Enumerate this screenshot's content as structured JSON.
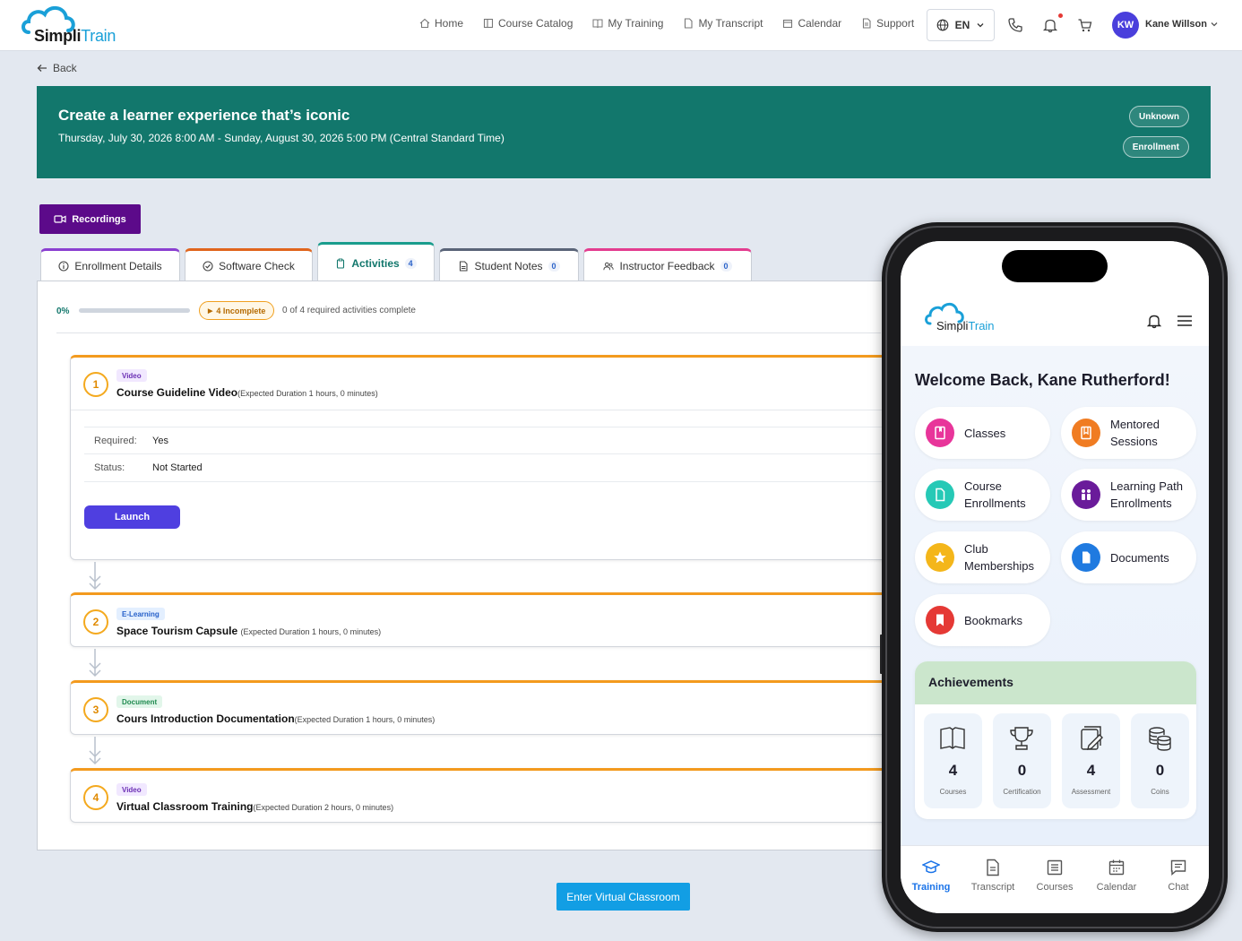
{
  "brand": {
    "name_a": "Simpli",
    "name_b": "Train"
  },
  "nav": {
    "items": [
      {
        "label": "Home",
        "icon": "home-icon"
      },
      {
        "label": "Course Catalog",
        "icon": "catalog-icon"
      },
      {
        "label": "My Training",
        "icon": "book-icon"
      },
      {
        "label": "My Transcript",
        "icon": "file-icon"
      },
      {
        "label": "Calendar",
        "icon": "calendar-icon"
      },
      {
        "label": "Support",
        "icon": "support-icon"
      }
    ],
    "language": "EN",
    "user_initials": "KW",
    "user_name": "Kane Willson"
  },
  "back_label": "Back",
  "banner": {
    "title": "Create a learner experience that’s iconic",
    "date": "Thursday, July 30, 2026 8:00 AM - Sunday, August 30, 2026 5:00 PM (Central Standard Time)",
    "pill_status": "Unknown",
    "pill_type": "Enrollment"
  },
  "recordings_label": "Recordings",
  "tabs": [
    {
      "label": "Enrollment Details",
      "count": ""
    },
    {
      "label": "Software Check",
      "count": ""
    },
    {
      "label": "Activities",
      "count": "4"
    },
    {
      "label": "Student Notes",
      "count": "0"
    },
    {
      "label": "Instructor Feedback",
      "count": "0"
    }
  ],
  "progress": {
    "percent_label": "0%",
    "fraction": 0,
    "incomplete_label": "4 Incomplete",
    "summary": "0 of 4 required activities complete"
  },
  "activities": [
    {
      "number": "1",
      "type": "Video",
      "title": "Course Guideline Video",
      "duration": "(Expected Duration 1 hours, 0 minutes)"
    },
    {
      "number": "2",
      "type": "E-Learning",
      "title": "Space Tourism Capsule ",
      "duration": "(Expected Duration 1 hours, 0 minutes)"
    },
    {
      "number": "3",
      "type": "Document",
      "title": "Cours Introduction Documentation",
      "duration": "(Expected Duration 1 hours, 0 minutes)"
    },
    {
      "number": "4",
      "type": "Video",
      "title": "Virtual Classroom Training",
      "duration": "(Expected Duration 2 hours, 0 minutes)"
    }
  ],
  "activity_details": {
    "required_key": "Required:",
    "required_value": "Yes",
    "status_key": "Status:",
    "status_value": "Not Started",
    "launch_label": "Launch"
  },
  "enter_classroom_label": "Enter Virtual Classroom",
  "mobile": {
    "brand_a": "Simpli",
    "brand_b": "Train",
    "welcome": "Welcome Back, Kane Rutherford!",
    "cards": [
      {
        "label_1": "Classes",
        "label_2": "",
        "color": "#e8359a"
      },
      {
        "label_1": "Mentored",
        "label_2": "Sessions",
        "color": "#f07c22"
      },
      {
        "label_1": "Course",
        "label_2": "Enrollments",
        "color": "#26c9b6"
      },
      {
        "label_1": "Learning Path",
        "label_2": "Enrollments",
        "color": "#6a1b9a"
      },
      {
        "label_1": "Club",
        "label_2": "Memberships",
        "color": "#f4b61a"
      },
      {
        "label_1": "Documents",
        "label_2": "",
        "color": "#1f7ae0"
      },
      {
        "label_1": "Bookmarks",
        "label_2": "",
        "color": "#e53935"
      }
    ],
    "achievements_title": "Achievements",
    "stats": [
      {
        "value": "4",
        "label": "Courses",
        "icon": "book-open-icon"
      },
      {
        "value": "0",
        "label": "Certification",
        "icon": "trophy-icon"
      },
      {
        "value": "4",
        "label": "Assessment",
        "icon": "assessment-icon"
      },
      {
        "value": "0",
        "label": "Coins",
        "icon": "coins-icon"
      }
    ],
    "tabbar": [
      {
        "label": "Training",
        "icon": "graduation-cap-icon"
      },
      {
        "label": "Transcript",
        "icon": "document-icon"
      },
      {
        "label": "Courses",
        "icon": "list-icon"
      },
      {
        "label": "Calendar",
        "icon": "calendar-icon"
      },
      {
        "label": "Chat",
        "icon": "chat-icon"
      }
    ]
  },
  "colors": {
    "banner": "#12776c",
    "recordings": "#5c0a8a",
    "launch": "#4f3fe0",
    "enter_button": "#129ee4",
    "activity_accent": "#f39a1e"
  }
}
